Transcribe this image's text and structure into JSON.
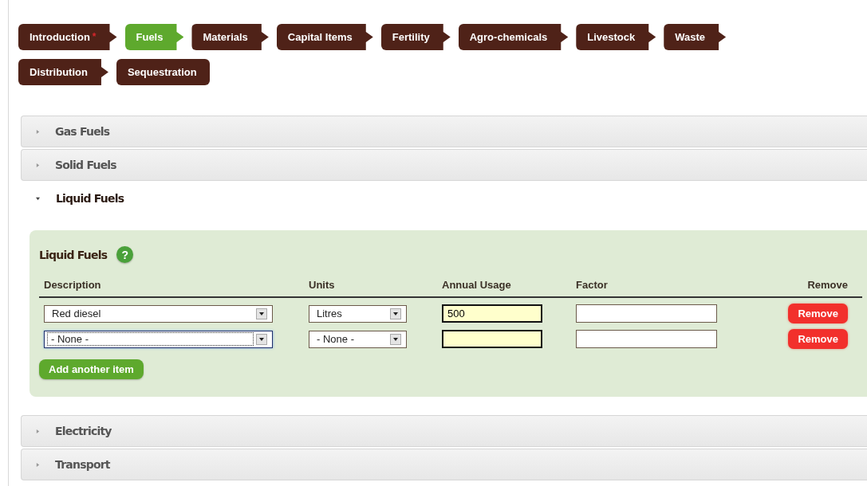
{
  "steps": [
    {
      "label": "Introduction",
      "marker": "*",
      "selected": false
    },
    {
      "label": "Fuels",
      "selected": true
    },
    {
      "label": "Materials",
      "selected": false
    },
    {
      "label": "Capital Items",
      "selected": false
    },
    {
      "label": "Fertility",
      "selected": false
    },
    {
      "label": "Agro-chemicals",
      "selected": false
    },
    {
      "label": "Livestock",
      "selected": false
    },
    {
      "label": "Waste",
      "selected": false
    },
    {
      "label": "Distribution",
      "selected": false
    },
    {
      "label": "Sequestration",
      "selected": false
    }
  ],
  "sections": [
    {
      "title": "Gas Fuels",
      "expanded": false
    },
    {
      "title": "Solid Fuels",
      "expanded": false
    },
    {
      "title": "Liquid Fuels",
      "expanded": true,
      "panel": {
        "title": "Liquid Fuels",
        "help_icon": "?",
        "columns": [
          "Description",
          "Units",
          "Annual Usage",
          "Factor",
          "Remove"
        ],
        "rows": [
          {
            "description": "Red diesel",
            "description_focused": false,
            "units": "Litres",
            "annual_usage": "500",
            "remove": "Remove"
          },
          {
            "description": "- None -",
            "description_focused": true,
            "units": "- None -",
            "remove": "Remove"
          }
        ],
        "add_button": "Add another item"
      }
    },
    {
      "title": "Electricity",
      "expanded": false
    },
    {
      "title": "Transport",
      "expanded": false
    }
  ]
}
